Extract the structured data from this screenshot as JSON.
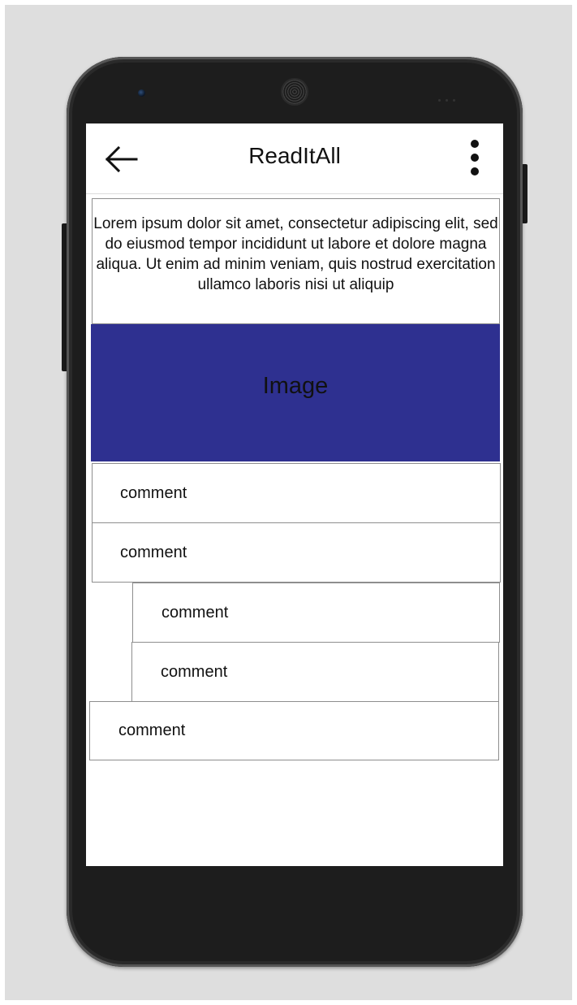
{
  "app_bar": {
    "title": "ReadItAll",
    "back_icon": "arrow-left-icon",
    "menu_icon": "more-vertical-icon"
  },
  "post": {
    "text": "Lorem ipsum dolor sit amet, consectetur adipiscing elit, sed do eiusmod tempor incididunt ut labore et dolore magna aliqua. Ut enim ad minim veniam, quis nostrud exercitation ullamco laboris nisi ut aliquip"
  },
  "image_placeholder": {
    "label": "Image",
    "color": "#2e3090"
  },
  "comments": [
    {
      "text": "comment",
      "level": 0
    },
    {
      "text": "comment",
      "level": 0
    },
    {
      "text": "comment",
      "level": 1
    },
    {
      "text": "comment",
      "level": 1
    },
    {
      "text": "comment",
      "level": 0
    }
  ]
}
